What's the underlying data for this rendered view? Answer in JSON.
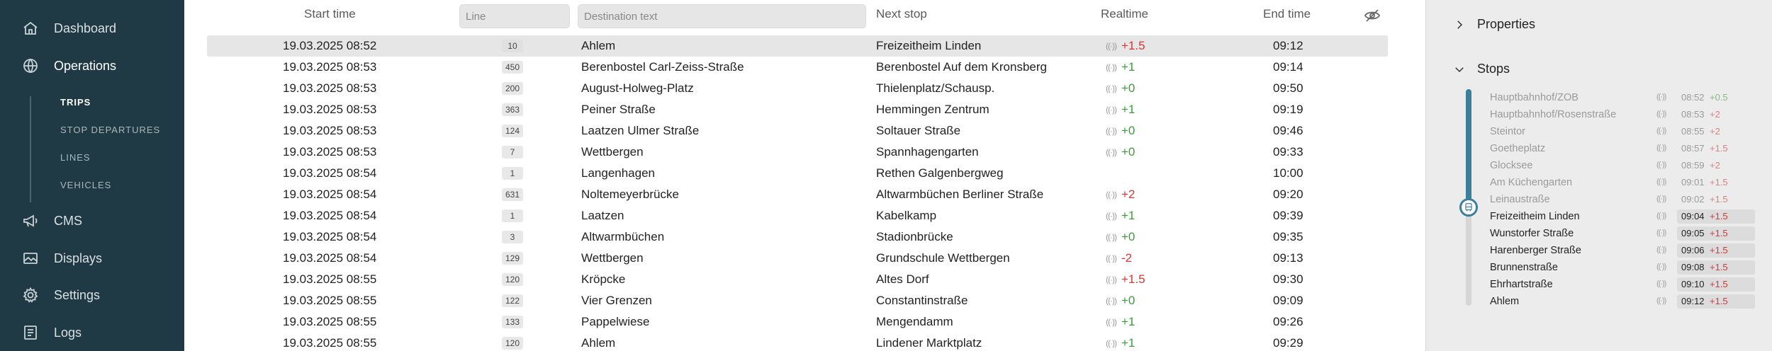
{
  "sidebar": {
    "items": [
      {
        "label": "Dashboard",
        "icon": "home-icon"
      },
      {
        "label": "Operations",
        "icon": "globe-icon"
      },
      {
        "label": "CMS",
        "icon": "megaphone-icon"
      },
      {
        "label": "Displays",
        "icon": "image-icon"
      },
      {
        "label": "Settings",
        "icon": "gear-icon"
      },
      {
        "label": "Logs",
        "icon": "list-icon"
      }
    ],
    "subitems": [
      {
        "label": "TRIPS"
      },
      {
        "label": "STOP DEPARTURES"
      },
      {
        "label": "LINES"
      },
      {
        "label": "VEHICLES"
      }
    ]
  },
  "table": {
    "headers": {
      "start": "Start time",
      "line_placeholder": "Line",
      "dest_placeholder": "Destination text",
      "next": "Next stop",
      "realtime": "Realtime",
      "end": "End time"
    },
    "rows": [
      {
        "start": "19.03.2025  08:52",
        "line": "10",
        "dest": "Ahlem",
        "next": "Freizeitheim Linden",
        "rt": "+1.5",
        "rt_class": "neg",
        "end": "09:12"
      },
      {
        "start": "19.03.2025  08:53",
        "line": "450",
        "dest": "Berenbostel Carl-Zeiss-Straße",
        "next": "Berenbostel Auf dem Kronsberg",
        "rt": "+1",
        "rt_class": "pos",
        "end": "09:14"
      },
      {
        "start": "19.03.2025  08:53",
        "line": "200",
        "dest": "August-Holweg-Platz",
        "next": "Thielenplatz/Schausp.",
        "rt": "+0",
        "rt_class": "pos",
        "end": "09:50"
      },
      {
        "start": "19.03.2025  08:53",
        "line": "363",
        "dest": "Peiner Straße",
        "next": "Hemmingen Zentrum",
        "rt": "+1",
        "rt_class": "pos",
        "end": "09:19"
      },
      {
        "start": "19.03.2025  08:53",
        "line": "124",
        "dest": "Laatzen Ulmer Straße",
        "next": "Soltauer Straße",
        "rt": "+0",
        "rt_class": "pos",
        "end": "09:46"
      },
      {
        "start": "19.03.2025  08:53",
        "line": "7",
        "dest": "Wettbergen",
        "next": "Spannhagengarten",
        "rt": "+0",
        "rt_class": "pos",
        "end": "09:33"
      },
      {
        "start": "19.03.2025  08:54",
        "line": "1",
        "dest": "Langenhagen",
        "next": "Rethen Galgenbergweg",
        "rt": "",
        "rt_class": "",
        "end": "10:00"
      },
      {
        "start": "19.03.2025  08:54",
        "line": "631",
        "dest": "Noltemeyerbrücke",
        "next": "Altwarmbüchen Berliner Straße",
        "rt": "+2",
        "rt_class": "neg",
        "end": "09:20"
      },
      {
        "start": "19.03.2025  08:54",
        "line": "1",
        "dest": "Laatzen",
        "next": "Kabelkamp",
        "rt": "+1",
        "rt_class": "pos",
        "end": "09:39"
      },
      {
        "start": "19.03.2025  08:54",
        "line": "3",
        "dest": "Altwarmbüchen",
        "next": "Stadionbrücke",
        "rt": "+0",
        "rt_class": "pos",
        "end": "09:35"
      },
      {
        "start": "19.03.2025  08:54",
        "line": "129",
        "dest": "Wettbergen",
        "next": "Grundschule Wettbergen",
        "rt": "-2",
        "rt_class": "neg",
        "end": "09:13"
      },
      {
        "start": "19.03.2025  08:55",
        "line": "120",
        "dest": "Kröpcke",
        "next": "Altes Dorf",
        "rt": "+1.5",
        "rt_class": "neg",
        "end": "09:30"
      },
      {
        "start": "19.03.2025  08:55",
        "line": "122",
        "dest": "Vier Grenzen",
        "next": "Constantinstraße",
        "rt": "+0",
        "rt_class": "pos",
        "end": "09:09"
      },
      {
        "start": "19.03.2025  08:55",
        "line": "133",
        "dest": "Pappelwiese",
        "next": "Mengendamm",
        "rt": "+1",
        "rt_class": "pos",
        "end": "09:26"
      },
      {
        "start": "19.03.2025  08:55",
        "line": "120",
        "dest": "Ahlem",
        "next": "Lindener Marktplatz",
        "rt": "+1",
        "rt_class": "pos",
        "end": "09:29"
      }
    ]
  },
  "panel": {
    "properties_label": "Properties",
    "stops_label": "Stops",
    "stops": [
      {
        "name": "Hauptbahnhof/ZOB",
        "time": "08:52",
        "delay": "+0.5",
        "cls": "pos",
        "state": "past"
      },
      {
        "name": "Hauptbahnhof/Rosenstraße",
        "time": "08:53",
        "delay": "+2",
        "cls": "neg",
        "state": "past"
      },
      {
        "name": "Steintor",
        "time": "08:55",
        "delay": "+2",
        "cls": "neg",
        "state": "past"
      },
      {
        "name": "Goetheplatz",
        "time": "08:57",
        "delay": "+1.5",
        "cls": "neg",
        "state": "past"
      },
      {
        "name": "Glocksee",
        "time": "08:59",
        "delay": "+2",
        "cls": "neg",
        "state": "past"
      },
      {
        "name": "Am Küchengarten",
        "time": "09:01",
        "delay": "+1.5",
        "cls": "neg",
        "state": "past"
      },
      {
        "name": "Leinaustraße",
        "time": "09:02",
        "delay": "+1.5",
        "cls": "neg",
        "state": "past"
      },
      {
        "name": "Freizeitheim Linden",
        "time": "09:04",
        "delay": "+1.5",
        "cls": "neg",
        "state": "current"
      },
      {
        "name": "Wunstorfer Straße",
        "time": "09:05",
        "delay": "+1.5",
        "cls": "neg",
        "state": "future"
      },
      {
        "name": "Harenberger Straße",
        "time": "09:06",
        "delay": "+1.5",
        "cls": "neg",
        "state": "future"
      },
      {
        "name": "Brunnenstraße",
        "time": "09:08",
        "delay": "+1.5",
        "cls": "neg",
        "state": "future"
      },
      {
        "name": "Ehrhartstraße",
        "time": "09:10",
        "delay": "+1.5",
        "cls": "neg",
        "state": "future"
      },
      {
        "name": "Ahlem",
        "time": "09:12",
        "delay": "+1.5",
        "cls": "neg",
        "state": "future"
      }
    ]
  },
  "colors": {
    "sidebar_bg": "#1f3a44",
    "accent": "#3b7f9c",
    "positive": "#3d9b3d",
    "negative": "#d93636"
  }
}
